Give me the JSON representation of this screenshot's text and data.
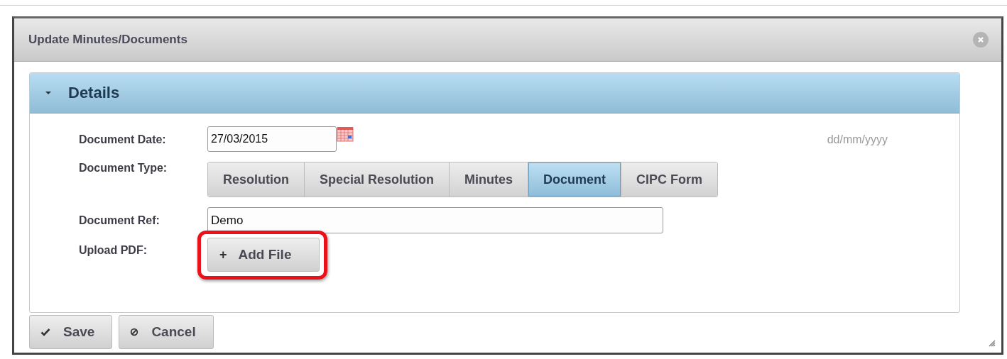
{
  "dialog": {
    "title": "Update Minutes/Documents"
  },
  "panel": {
    "title": "Details",
    "expanded": true
  },
  "document_date": {
    "label": "Document Date:",
    "value": "27/03/2015",
    "hint": "dd/mm/yyyy"
  },
  "document_type": {
    "label": "Document Type:",
    "options": [
      {
        "label": "Resolution",
        "selected": false
      },
      {
        "label": "Special Resolution",
        "selected": false
      },
      {
        "label": "Minutes",
        "selected": false
      },
      {
        "label": "Document",
        "selected": true
      },
      {
        "label": "CIPC Form",
        "selected": false
      }
    ]
  },
  "document_ref": {
    "label": "Document Ref:",
    "value": "Demo"
  },
  "upload": {
    "label": "Upload PDF:",
    "button": "Add File",
    "button_icon": "+",
    "highlighted": true
  },
  "buttons": [
    {
      "label": "Save",
      "kind": "save"
    },
    {
      "label": "Cancel",
      "kind": "cancel"
    }
  ]
}
